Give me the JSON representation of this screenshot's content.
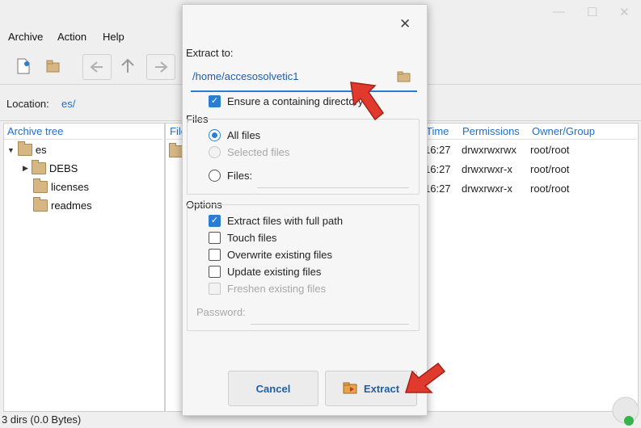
{
  "window_controls": {
    "minimize": "—",
    "maximize": "☐",
    "close": "✕"
  },
  "menu": [
    "Archive",
    "Action",
    "Help"
  ],
  "location": {
    "label": "Location:",
    "value": "es/"
  },
  "tree": {
    "header": "Archive tree",
    "items": [
      {
        "label": "es",
        "expanded": true
      },
      {
        "label": "DEBS",
        "expanded": false
      },
      {
        "label": "licenses"
      },
      {
        "label": "readmes"
      }
    ]
  },
  "file_list": {
    "headers": {
      "file": "File",
      "time": "Time",
      "permissions": "Permissions",
      "owner": "Owner/Group"
    },
    "rows": [
      {
        "time": "16:27",
        "permissions": "drwxrwxrwx",
        "owner": "root/root"
      },
      {
        "time": "16:27",
        "permissions": "drwxrwxr-x",
        "owner": "root/root"
      },
      {
        "time": "16:27",
        "permissions": "drwxrwxr-x",
        "owner": "root/root"
      }
    ]
  },
  "status": "3 dirs (0.0 Bytes)",
  "dialog": {
    "close": "✕",
    "extract_to_label": "Extract to:",
    "extract_to_value": "/home/accesosolvetic1",
    "ensure_dir": {
      "label": "Ensure a containing directory",
      "checked": true
    },
    "files_label": "Files",
    "files_options": [
      {
        "label": "All files",
        "selected": true,
        "enabled": true
      },
      {
        "label": "Selected files",
        "selected": false,
        "enabled": false
      },
      {
        "label": "Files:",
        "selected": false,
        "enabled": true
      }
    ],
    "files_pattern_value": "",
    "options_label": "Options",
    "options": [
      {
        "label": "Extract files with full path",
        "checked": true,
        "enabled": true
      },
      {
        "label": "Touch files",
        "checked": false,
        "enabled": true
      },
      {
        "label": "Overwrite existing files",
        "checked": false,
        "enabled": true
      },
      {
        "label": "Update existing files",
        "checked": false,
        "enabled": true
      },
      {
        "label": "Freshen existing files",
        "checked": false,
        "enabled": false
      }
    ],
    "password_label": "Password:",
    "password_value": "",
    "cancel_label": "Cancel",
    "extract_label": "Extract"
  },
  "colors": {
    "accent": "#2a7ed2",
    "header_text": "#1f6fc6",
    "arrow": "#e03a2e"
  }
}
